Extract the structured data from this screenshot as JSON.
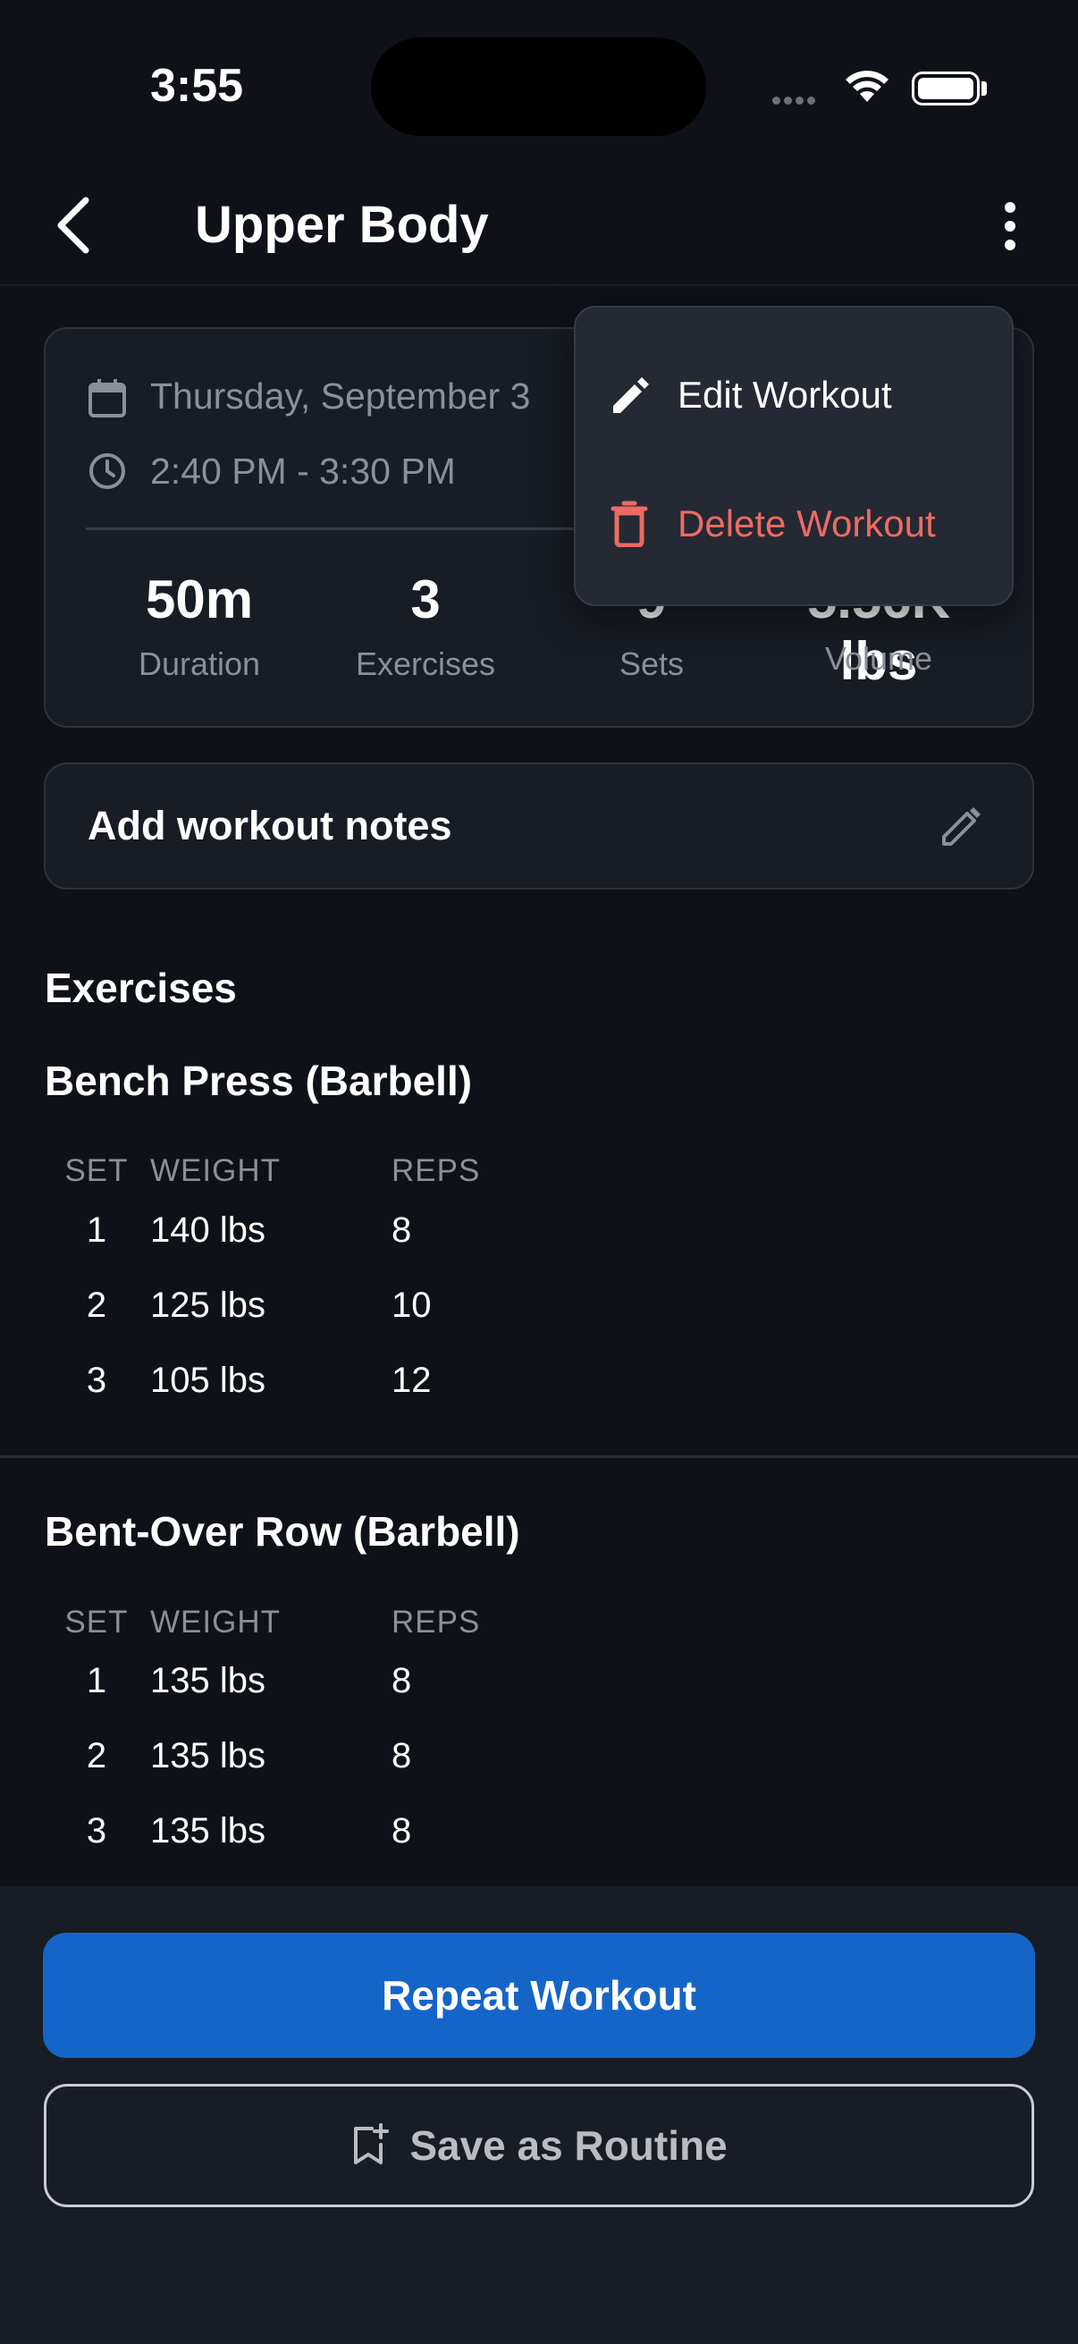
{
  "status_bar": {
    "time": "3:55"
  },
  "header": {
    "title": "Upper Body"
  },
  "summary": {
    "date": "Thursday, September 3",
    "time_range": "2:40 PM - 3:30 PM",
    "stats": [
      {
        "value": "50m",
        "label": "Duration"
      },
      {
        "value": "3",
        "label": "Exercises"
      },
      {
        "value": "9",
        "label": "Sets"
      },
      {
        "value": "5.56K lbs",
        "label": "Volume"
      }
    ]
  },
  "notes": {
    "label": "Add workout notes"
  },
  "exercises_section": {
    "title": "Exercises",
    "columns": {
      "set": "SET",
      "weight": "WEIGHT",
      "reps": "REPS"
    },
    "items": [
      {
        "name": "Bench Press (Barbell)",
        "sets": [
          {
            "set": "1",
            "weight": "140 lbs",
            "reps": "8"
          },
          {
            "set": "2",
            "weight": "125 lbs",
            "reps": "10"
          },
          {
            "set": "3",
            "weight": "105 lbs",
            "reps": "12"
          }
        ]
      },
      {
        "name": "Bent-Over Row (Barbell)",
        "sets": [
          {
            "set": "1",
            "weight": "135 lbs",
            "reps": "8"
          },
          {
            "set": "2",
            "weight": "135 lbs",
            "reps": "8"
          },
          {
            "set": "3",
            "weight": "135 lbs",
            "reps": "8"
          }
        ]
      }
    ]
  },
  "actions": {
    "repeat_label": "Repeat Workout",
    "save_label": "Save as Routine"
  },
  "menu": {
    "items": [
      {
        "label": "Edit Workout",
        "icon": "pencil-icon",
        "color": "#ffffff"
      },
      {
        "label": "Delete Workout",
        "icon": "trash-icon",
        "color": "#ee6b63"
      }
    ]
  },
  "colors": {
    "background": "#0e1117",
    "card": "#181c24",
    "accent": "#1565c8",
    "danger": "#ee6b63",
    "muted_text": "#8b8f98"
  }
}
